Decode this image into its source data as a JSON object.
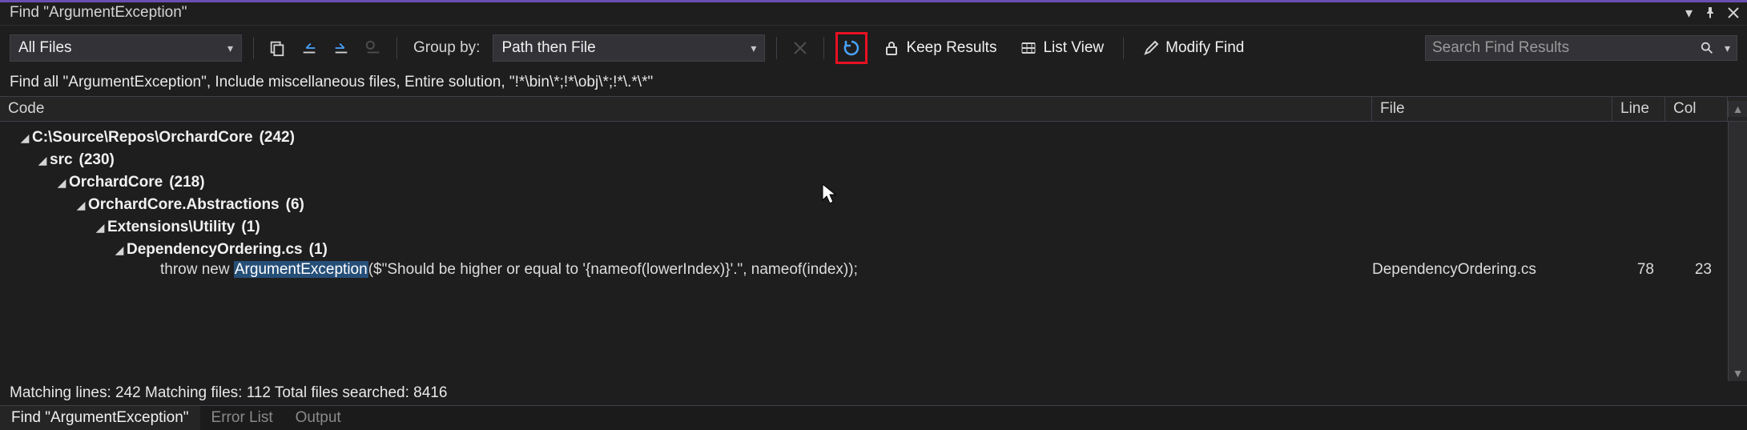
{
  "title": "Find \"ArgumentException\"",
  "titlebar_icons": {
    "menu": "▾",
    "pin": "📌",
    "close": "✕"
  },
  "toolbar": {
    "filescope": "All Files",
    "groupby_label": "Group by:",
    "groupby_value": "Path then File",
    "keep_results": "Keep Results",
    "list_view": "List View",
    "modify_find": "Modify Find",
    "search_placeholder": "Search Find Results"
  },
  "query_summary": "Find all \"ArgumentException\", Include miscellaneous files, Entire solution, \"!*\\bin\\*;!*\\obj\\*;!*\\.*\\*\"",
  "columns": {
    "code": "Code",
    "file": "File",
    "line": "Line",
    "col": "Col"
  },
  "tree": [
    {
      "indent": 1,
      "label": "C:\\Source\\Repos\\OrchardCore",
      "count": "(242)"
    },
    {
      "indent": 2,
      "label": "src",
      "count": "(230)"
    },
    {
      "indent": 3,
      "label": "OrchardCore",
      "count": "(218)"
    },
    {
      "indent": 4,
      "label": "OrchardCore.Abstractions",
      "count": "(6)"
    },
    {
      "indent": 5,
      "label": "Extensions\\Utility",
      "count": "(1)"
    },
    {
      "indent": 6,
      "label": "DependencyOrdering.cs",
      "count": "(1)"
    }
  ],
  "result": {
    "pre": "throw new ",
    "match": "ArgumentException",
    "post": "($\"Should be higher or equal to '{nameof(lowerIndex)}'.\", nameof(index));",
    "file": "DependencyOrdering.cs",
    "line": "78",
    "col": "23"
  },
  "footer": "Matching lines: 242 Matching files: 112 Total files searched: 8416",
  "tabs": {
    "active": "Find \"ArgumentException\"",
    "t2": "Error List",
    "t3": "Output"
  }
}
